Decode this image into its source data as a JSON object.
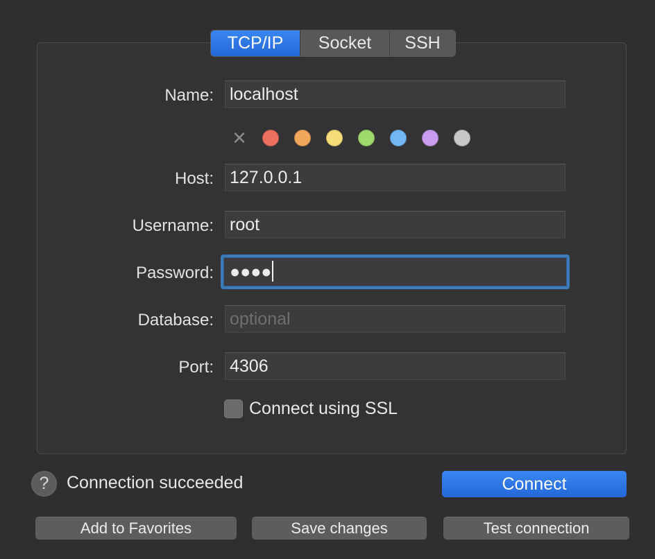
{
  "tabs": [
    {
      "label": "TCP/IP",
      "active": true
    },
    {
      "label": "Socket",
      "active": false
    },
    {
      "label": "SSH",
      "active": false
    }
  ],
  "form": {
    "name_label": "Name:",
    "name_value": "localhost",
    "host_label": "Host:",
    "host_value": "127.0.0.1",
    "username_label": "Username:",
    "username_value": "root",
    "password_label": "Password:",
    "password_value": "●●●●",
    "database_label": "Database:",
    "database_placeholder": "optional",
    "port_label": "Port:",
    "port_value": "4306",
    "ssl_label": "Connect using SSL",
    "ssl_checked": false
  },
  "colors": {
    "clear_icon": "clear-x-icon",
    "swatches": [
      "#ec6f5f",
      "#f2a85a",
      "#f4dc78",
      "#9fd86c",
      "#72b8f6",
      "#c99cf0",
      "#c8c8c8"
    ],
    "swatch_names": [
      "red",
      "orange",
      "yellow",
      "green",
      "blue",
      "purple",
      "gray"
    ],
    "accent": "#2f77e6"
  },
  "footer": {
    "help_icon": "?",
    "status_text": "Connection succeeded",
    "connect_label": "Connect",
    "add_favorites_label": "Add to Favorites",
    "save_changes_label": "Save changes",
    "test_connection_label": "Test connection"
  }
}
